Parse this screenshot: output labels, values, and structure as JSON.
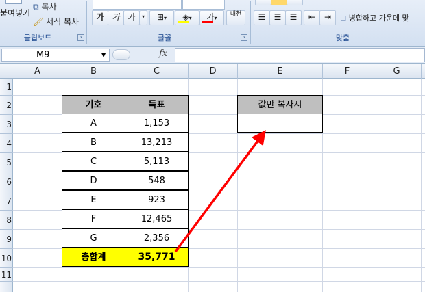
{
  "ribbon": {
    "clipboard": {
      "paste_label": "붙여넣기",
      "copy_label": "복사",
      "format_painter_label": "서식 복사",
      "group_label": "클립보드"
    },
    "font": {
      "bold": "가",
      "italic": "가",
      "underline": "가",
      "font_color_glyph": "가",
      "phonetic_glyph": "내천",
      "group_label": "글꼴"
    },
    "alignment": {
      "merge_center_label": "병합하고 가운데 맞",
      "group_label": "맞춤"
    }
  },
  "formula_bar": {
    "name_box": "M9",
    "fx_label": "fx",
    "formula": ""
  },
  "columns": [
    "A",
    "B",
    "C",
    "D",
    "E",
    "F",
    "G"
  ],
  "rows": [
    "1",
    "2",
    "3",
    "4",
    "5",
    "6",
    "7",
    "8",
    "9",
    "10",
    "11"
  ],
  "table": {
    "headers": [
      "기호",
      "득표"
    ],
    "rows": [
      [
        "A",
        "1,153"
      ],
      [
        "B",
        "13,213"
      ],
      [
        "C",
        "5,113"
      ],
      [
        "D",
        "548"
      ],
      [
        "E",
        "923"
      ],
      [
        "F",
        "12,465"
      ],
      [
        "G",
        "2,356"
      ]
    ],
    "total": [
      "총합계",
      "35,771"
    ]
  },
  "side_box": {
    "header": "값만 복사시",
    "value": ""
  },
  "colors": {
    "header_fill": "#bfbfbf",
    "total_fill": "#ffff00",
    "arrow": "#ff0000",
    "font_color_bar": "#ff0000",
    "highlight_bar": "#ffff00"
  }
}
